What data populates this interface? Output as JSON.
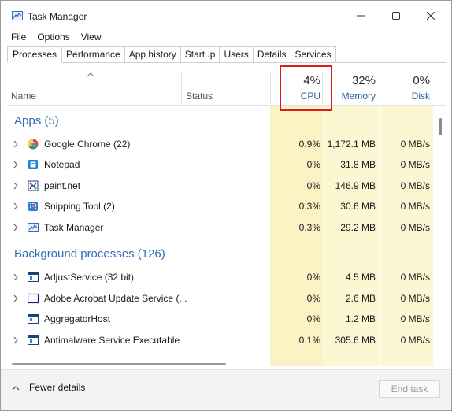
{
  "window": {
    "title": "Task Manager"
  },
  "menu": [
    "File",
    "Options",
    "View"
  ],
  "tabs": [
    "Processes",
    "Performance",
    "App history",
    "Startup",
    "Users",
    "Details",
    "Services"
  ],
  "active_tab": "Processes",
  "columns": {
    "name": "Name",
    "status": "Status",
    "cpu": {
      "percent": "4%",
      "label": "CPU"
    },
    "memory": {
      "percent": "32%",
      "label": "Memory"
    },
    "disk": {
      "percent": "0%",
      "label": "Disk"
    }
  },
  "apps_section": {
    "title": "Apps (5)",
    "rows": [
      {
        "name": "Google Chrome (22)",
        "icon": "chrome-icon",
        "cpu": "0.9%",
        "memory": "1,172.1 MB",
        "disk": "0 MB/s",
        "expandable": true
      },
      {
        "name": "Notepad",
        "icon": "notepad-icon",
        "cpu": "0%",
        "memory": "31.8 MB",
        "disk": "0 MB/s",
        "expandable": true
      },
      {
        "name": "paint.net",
        "icon": "paintnet-icon",
        "cpu": "0%",
        "memory": "146.9 MB",
        "disk": "0 MB/s",
        "expandable": true
      },
      {
        "name": "Snipping Tool (2)",
        "icon": "snipping-tool-icon",
        "cpu": "0.3%",
        "memory": "30.6 MB",
        "disk": "0 MB/s",
        "expandable": true
      },
      {
        "name": "Task Manager",
        "icon": "task-manager-icon",
        "cpu": "0.3%",
        "memory": "29.2 MB",
        "disk": "0 MB/s",
        "expandable": true
      }
    ]
  },
  "background_section": {
    "title": "Background processes (126)",
    "rows": [
      {
        "name": "AdjustService (32 bit)",
        "icon": "service-window-icon",
        "cpu": "0%",
        "memory": "4.5 MB",
        "disk": "0 MB/s",
        "expandable": true
      },
      {
        "name": "Adobe Acrobat Update Service (...",
        "icon": "service-window-icon",
        "cpu": "0%",
        "memory": "2.6 MB",
        "disk": "0 MB/s",
        "expandable": true
      },
      {
        "name": "AggregatorHost",
        "icon": "service-window-icon",
        "cpu": "0%",
        "memory": "1.2 MB",
        "disk": "0 MB/s",
        "expandable": false
      },
      {
        "name": "Antimalware Service Executable",
        "icon": "service-window-icon",
        "cpu": "0.1%",
        "memory": "305.6 MB",
        "disk": "0 MB/s",
        "expandable": true
      }
    ]
  },
  "footer": {
    "fewer_details": "Fewer details",
    "end_task": "End task"
  },
  "colors": {
    "cpu_column_bg": "#fbf3c4",
    "memory_column_bg": "#fcf6d2",
    "disk_column_bg": "#fcf6d2",
    "section_title": "#2f6db5",
    "highlight_border": "#e01b1b"
  }
}
